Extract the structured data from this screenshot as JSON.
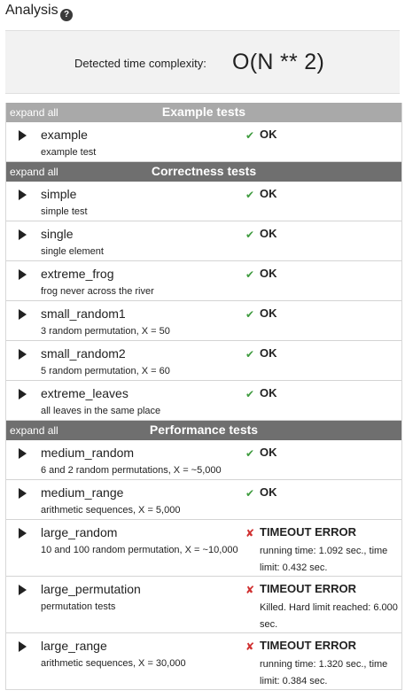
{
  "header": {
    "title": "Analysis",
    "help_icon": "question-circle-icon"
  },
  "complexity": {
    "label": "Detected time complexity:",
    "value": "O(N ** 2)"
  },
  "colors": {
    "ok": "#3f9b3f",
    "error": "#d03030",
    "example_header": "#a9a9a9",
    "group_header": "#6f6f6f"
  },
  "sections": [
    {
      "title": "Example tests",
      "expand_label": "expand all",
      "tests": [
        {
          "name": "example",
          "desc": "example test",
          "mark": "✔",
          "status": "OK"
        }
      ]
    },
    {
      "title": "Correctness tests",
      "expand_label": "expand all",
      "tests": [
        {
          "name": "simple",
          "desc": "simple test",
          "mark": "✔",
          "status": "OK"
        },
        {
          "name": "single",
          "desc": "single element",
          "mark": "✔",
          "status": "OK"
        },
        {
          "name": "extreme_frog",
          "desc": "frog never across the river",
          "mark": "✔",
          "status": "OK"
        },
        {
          "name": "small_random1",
          "desc": "3 random permutation, X = 50",
          "mark": "✔",
          "status": "OK"
        },
        {
          "name": "small_random2",
          "desc": "5 random permutation, X = 60",
          "mark": "✔",
          "status": "OK"
        },
        {
          "name": "extreme_leaves",
          "desc": "all leaves in the same place",
          "mark": "✔",
          "status": "OK"
        }
      ]
    },
    {
      "title": "Performance tests",
      "expand_label": "expand all",
      "tests": [
        {
          "name": "medium_random",
          "desc": "6 and 2 random permutations, X = ~5,000",
          "mark": "✔",
          "status": "OK"
        },
        {
          "name": "medium_range",
          "desc": "arithmetic sequences, X = 5,000",
          "mark": "✔",
          "status": "OK"
        },
        {
          "name": "large_random",
          "desc": "10 and 100 random permutation, X = ~10,000",
          "mark": "✘",
          "status": "TIMEOUT ERROR",
          "detail": "running time: 1.092 sec., time limit: 0.432 sec."
        },
        {
          "name": "large_permutation",
          "desc": "permutation tests",
          "mark": "✘",
          "status": "TIMEOUT ERROR",
          "detail": "Killed. Hard limit reached: 6.000 sec."
        },
        {
          "name": "large_range",
          "desc": "arithmetic sequences, X = 30,000",
          "mark": "✘",
          "status": "TIMEOUT ERROR",
          "detail": "running time: 1.320 sec., time limit: 0.384 sec."
        }
      ]
    }
  ]
}
